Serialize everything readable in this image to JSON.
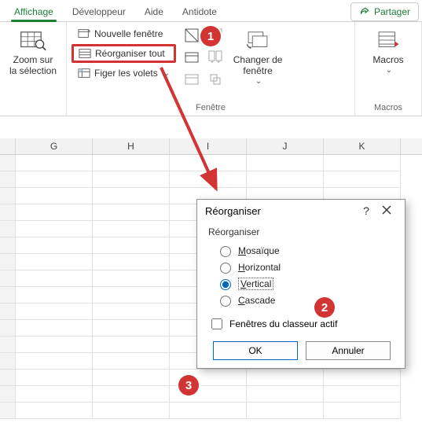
{
  "tabs": {
    "affichage": "Affichage",
    "dev": "Développeur",
    "aide": "Aide",
    "antidote": "Antidote"
  },
  "share": {
    "label": "Partager"
  },
  "ribbon": {
    "zoom": {
      "label": "Zoom sur\nla sélection"
    },
    "window": {
      "new_window": "Nouvelle fenêtre",
      "arrange_all": "Réorganiser tout",
      "freeze": "Figer les volets",
      "switch": "Changer de\nfenêtre",
      "group_label": "Fenêtre"
    },
    "macros": {
      "label": "Macros",
      "group_label": "Macros"
    }
  },
  "columns": [
    "G",
    "H",
    "I",
    "J",
    "K"
  ],
  "dialog": {
    "title": "Réorganiser",
    "help": "?",
    "group_label": "Réorganiser",
    "options": {
      "tile": "osaïque",
      "tile_u": "M",
      "horiz": "orizontal",
      "horiz_u": "H",
      "vert": "ertical",
      "vert_u": "V",
      "cascade": "ascade",
      "cascade_u": "C"
    },
    "checkbox": {
      "u": "F",
      "rest": "enêtres du classeur actif"
    },
    "ok": "OK",
    "cancel": "Annuler"
  },
  "annotations": {
    "b1": "1",
    "b2": "2",
    "b3": "3"
  }
}
